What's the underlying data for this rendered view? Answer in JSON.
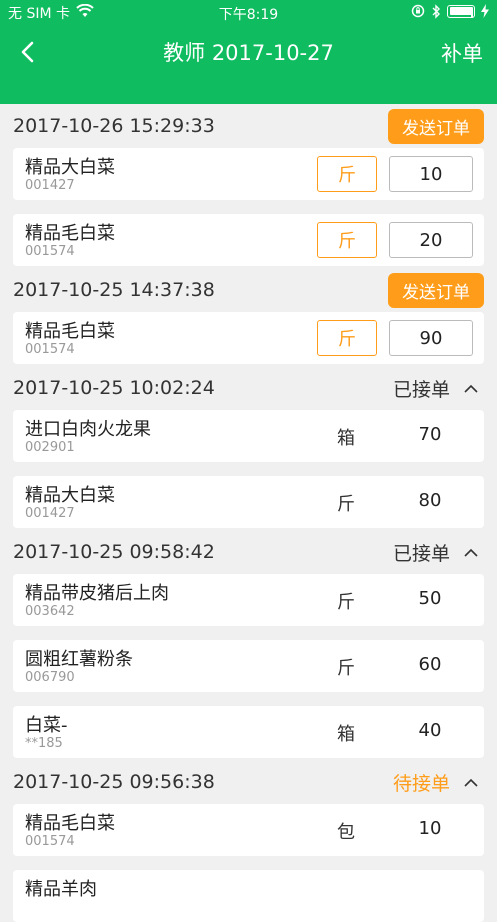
{
  "status_bar": {
    "carrier": "无 SIM 卡",
    "time": "下午8:19"
  },
  "nav": {
    "title": "教师 2017-10-27",
    "action": "补单"
  },
  "orders": [
    {
      "date": "2017-10-26 15:29:33",
      "action_label": "发送订单",
      "items": [
        {
          "name": "精品大白菜",
          "code": "001427",
          "unit": "斤",
          "qty": "10"
        },
        {
          "name": "精品毛白菜",
          "code": "001574",
          "unit": "斤",
          "qty": "20"
        }
      ]
    },
    {
      "date": "2017-10-25 14:37:38",
      "action_label": "发送订单",
      "items": [
        {
          "name": "精品毛白菜",
          "code": "001574",
          "unit": "斤",
          "qty": "90"
        }
      ]
    },
    {
      "date": "2017-10-25 10:02:24",
      "status": "已接单",
      "items": [
        {
          "name": "进口白肉火龙果",
          "code": "002901",
          "unit": "箱",
          "qty": "70"
        },
        {
          "name": "精品大白菜",
          "code": "001427",
          "unit": "斤",
          "qty": "80"
        }
      ]
    },
    {
      "date": "2017-10-25 09:58:42",
      "status": "已接单",
      "items": [
        {
          "name": "精品带皮猪后上肉",
          "code": "003642",
          "unit": "斤",
          "qty": "50"
        },
        {
          "name": "圆粗红薯粉条",
          "code": "006790",
          "unit": "斤",
          "qty": "60"
        },
        {
          "name": "白菜-",
          "code": "**185",
          "unit": "箱",
          "qty": "40"
        }
      ]
    },
    {
      "date": "2017-10-25 09:56:38",
      "status": "待接单",
      "items": [
        {
          "name": "精品毛白菜",
          "code": "001574",
          "unit": "包",
          "qty": "10"
        },
        {
          "name": "精品羊肉",
          "code": "",
          "unit": "",
          "qty": ""
        }
      ]
    }
  ],
  "colors": {
    "brand_green": "#0fbc5f",
    "accent_orange": "#ff9d1a"
  }
}
